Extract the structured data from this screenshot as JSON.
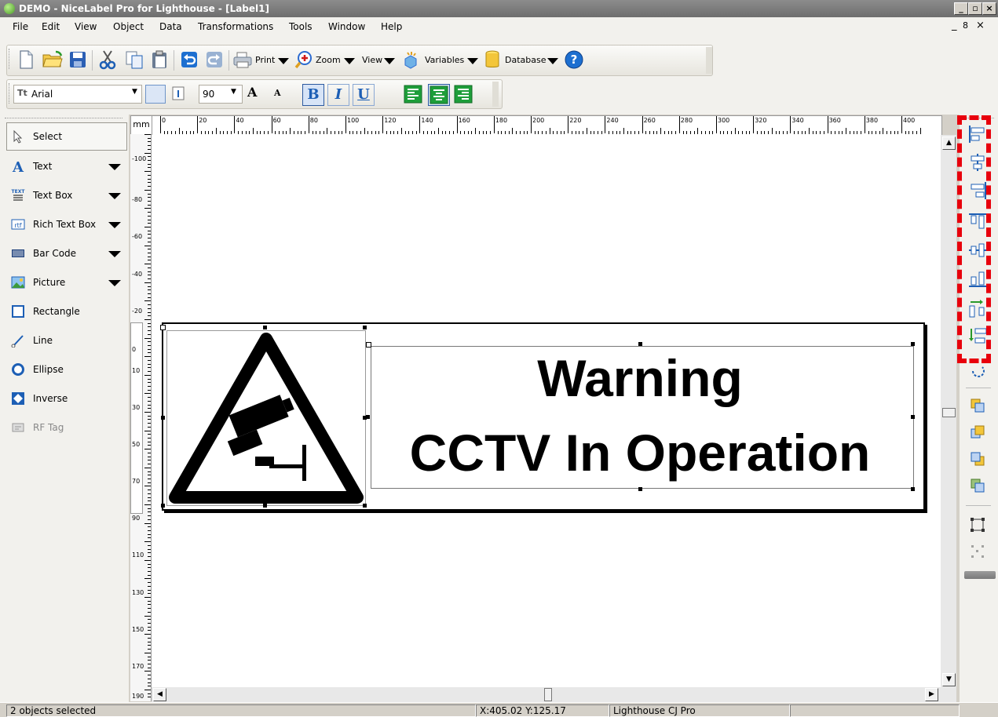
{
  "window": {
    "title": "DEMO - NiceLabel Pro for Lighthouse - [Label1]",
    "mdi_controls": [
      "_",
      "8",
      "×"
    ]
  },
  "menu": [
    "File",
    "Edit",
    "View",
    "Object",
    "Data",
    "Transformations",
    "Tools",
    "Window",
    "Help"
  ],
  "toolbar": {
    "print_label": "Print",
    "zoom_label": "Zoom",
    "view_label": "View",
    "variables_label": "Variables",
    "database_label": "Database"
  },
  "format_bar": {
    "font_name": "Arial",
    "font_size": "90",
    "bold_glyph": "B",
    "italic_glyph": "I",
    "underline_glyph": "U",
    "grow_glyph": "A",
    "shrink_glyph": "A"
  },
  "tools": [
    {
      "label": "Select",
      "icon": "pointer-icon",
      "dropdown": false
    },
    {
      "label": "Text",
      "icon": "text-icon",
      "dropdown": true
    },
    {
      "label": "Text Box",
      "icon": "textbox-icon",
      "dropdown": true
    },
    {
      "label": "Rich Text Box",
      "icon": "rtf-icon",
      "dropdown": true
    },
    {
      "label": "Bar Code",
      "icon": "barcode-icon",
      "dropdown": true
    },
    {
      "label": "Picture",
      "icon": "picture-icon",
      "dropdown": true
    },
    {
      "label": "Rectangle",
      "icon": "rectangle-icon",
      "dropdown": false
    },
    {
      "label": "Line",
      "icon": "line-icon",
      "dropdown": false
    },
    {
      "label": "Ellipse",
      "icon": "ellipse-icon",
      "dropdown": false
    },
    {
      "label": "Inverse",
      "icon": "inverse-icon",
      "dropdown": false
    },
    {
      "label": "RF Tag",
      "icon": "rftag-icon",
      "dropdown": false
    }
  ],
  "ruler": {
    "unit": "mm",
    "h_labels": [
      "0",
      "20",
      "40",
      "60",
      "80",
      "100",
      "120",
      "140",
      "160",
      "180",
      "200",
      "220",
      "240",
      "260",
      "280",
      "300",
      "320",
      "340",
      "360",
      "380",
      "400"
    ],
    "v_labels": [
      "-100",
      "-80",
      "-60",
      "-40",
      "-20",
      "0",
      "10",
      "30",
      "50",
      "70",
      "90",
      "110",
      "130",
      "150",
      "170",
      "190"
    ]
  },
  "label": {
    "line1": "Warning",
    "line2": "CCTV In Operation"
  },
  "align_tools": [
    "align-left-icon",
    "align-center-h-icon",
    "align-right-icon",
    "align-top-icon",
    "align-middle-v-icon",
    "align-bottom-icon",
    "space-evenly-h-icon",
    "space-evenly-v-icon"
  ],
  "status": {
    "selection": "2 objects selected",
    "coords": "X:405.02 Y:125.17",
    "printer": "Lighthouse CJ Pro"
  },
  "colors": {
    "highlight": "#e8000c",
    "accent_blue": "#1d5fb5"
  }
}
